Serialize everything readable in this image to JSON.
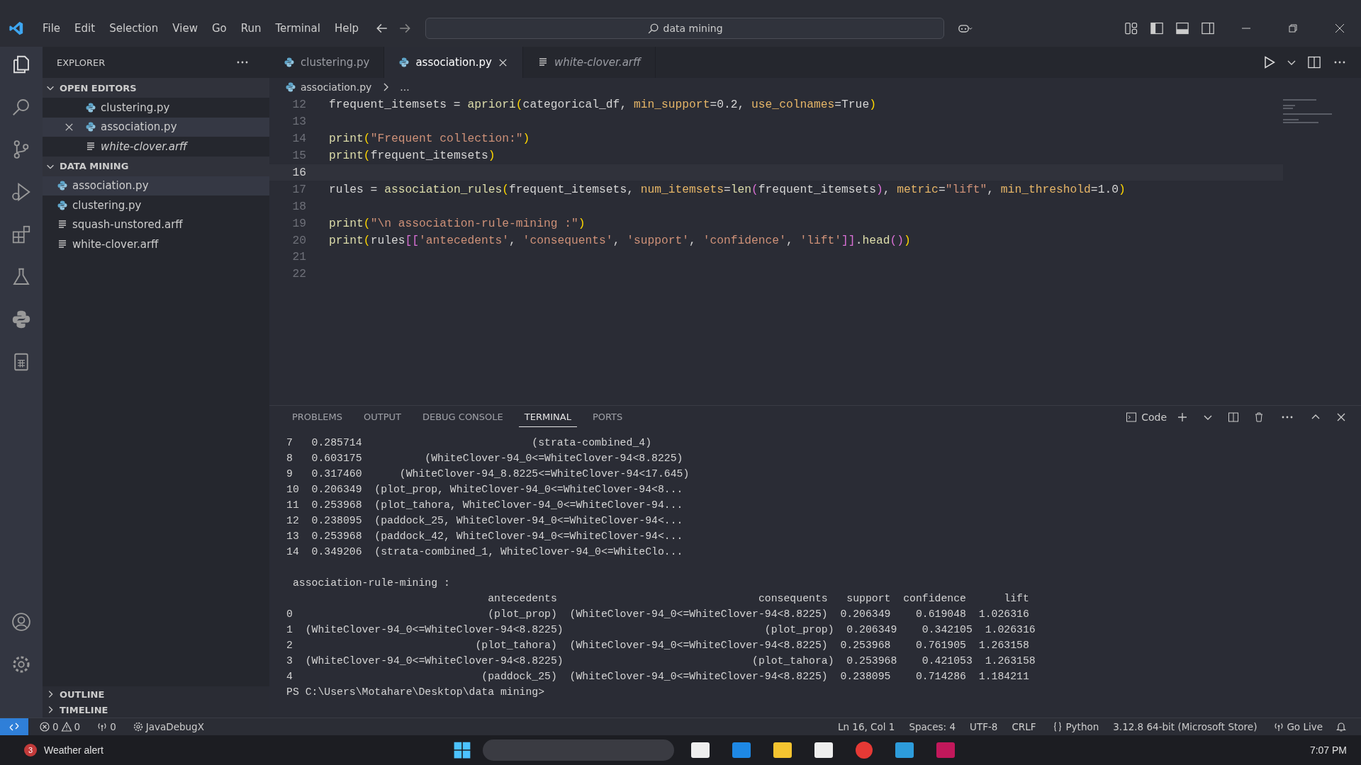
{
  "menu": [
    "File",
    "Edit",
    "Selection",
    "View",
    "Go",
    "Run",
    "Terminal",
    "Help"
  ],
  "search": {
    "value": "data mining"
  },
  "sidebar": {
    "title": "EXPLORER",
    "sections": [
      {
        "title": "OPEN EDITORS",
        "expanded": true,
        "items": [
          {
            "name": "clustering.py",
            "kind": "python",
            "selected": false,
            "preview": false,
            "closable": false
          },
          {
            "name": "association.py",
            "kind": "python",
            "selected": true,
            "preview": false,
            "closable": true
          },
          {
            "name": "white-clover.arff",
            "kind": "text",
            "selected": false,
            "preview": true,
            "closable": false
          }
        ]
      },
      {
        "title": "DATA MINING",
        "expanded": true,
        "items": [
          {
            "name": "association.py",
            "kind": "python",
            "selected": true,
            "preview": false
          },
          {
            "name": "clustering.py",
            "kind": "python",
            "selected": false,
            "preview": false
          },
          {
            "name": "squash-unstored.arff",
            "kind": "text",
            "selected": false,
            "preview": false
          },
          {
            "name": "white-clover.arff",
            "kind": "text",
            "selected": false,
            "preview": false
          }
        ]
      }
    ],
    "bottom_sections": [
      {
        "title": "OUTLINE",
        "expanded": false
      },
      {
        "title": "TIMELINE",
        "expanded": false
      }
    ]
  },
  "tabs": [
    {
      "label": "clustering.py",
      "kind": "python",
      "selected": false,
      "preview": false
    },
    {
      "label": "association.py",
      "kind": "python",
      "selected": true,
      "preview": false
    },
    {
      "label": "white-clover.arff",
      "kind": "text",
      "selected": false,
      "preview": true
    }
  ],
  "breadcrumb": {
    "file": "association.py",
    "rest": "..."
  },
  "editor": {
    "lines": [
      {
        "number": "12",
        "current": false,
        "tokens": [
          {
            "kind": "plain",
            "text": "frequent_itemsets = "
          },
          {
            "kind": "fn",
            "text": "apriori"
          },
          {
            "kind": "p1",
            "text": "("
          },
          {
            "kind": "plain",
            "text": "categorical_df, "
          },
          {
            "kind": "param",
            "text": "min_support"
          },
          {
            "kind": "plain",
            "text": "=0.2, "
          },
          {
            "kind": "param",
            "text": "use_colnames"
          },
          {
            "kind": "plain",
            "text": "=True"
          },
          {
            "kind": "p1",
            "text": ")"
          }
        ]
      },
      {
        "number": "13",
        "current": false
      },
      {
        "number": "14",
        "current": false,
        "tokens": [
          {
            "kind": "fn",
            "text": "print"
          },
          {
            "kind": "p1",
            "text": "("
          },
          {
            "kind": "str",
            "text": "\"Frequent collection:\""
          },
          {
            "kind": "p1",
            "text": ")"
          }
        ]
      },
      {
        "number": "15",
        "current": false,
        "tokens": [
          {
            "kind": "fn",
            "text": "print"
          },
          {
            "kind": "p1",
            "text": "("
          },
          {
            "kind": "plain",
            "text": "frequent_itemsets"
          },
          {
            "kind": "p1",
            "text": ")"
          }
        ]
      },
      {
        "number": "16",
        "current": true
      },
      {
        "number": "17",
        "current": false,
        "tokens": [
          {
            "kind": "plain",
            "text": "rules = "
          },
          {
            "kind": "fn",
            "text": "association_rules"
          },
          {
            "kind": "p1",
            "text": "("
          },
          {
            "kind": "plain",
            "text": "frequent_itemsets, "
          },
          {
            "kind": "param",
            "text": "num_itemsets"
          },
          {
            "kind": "plain",
            "text": "="
          },
          {
            "kind": "fn",
            "text": "len"
          },
          {
            "kind": "p2",
            "text": "("
          },
          {
            "kind": "plain",
            "text": "frequent_itemsets"
          },
          {
            "kind": "p2",
            "text": ")"
          },
          {
            "kind": "plain",
            "text": ", "
          },
          {
            "kind": "param",
            "text": "metric"
          },
          {
            "kind": "plain",
            "text": "="
          },
          {
            "kind": "str",
            "text": "\"lift\""
          },
          {
            "kind": "plain",
            "text": ", "
          },
          {
            "kind": "param",
            "text": "min_threshold"
          },
          {
            "kind": "plain",
            "text": "=1.0"
          },
          {
            "kind": "p1",
            "text": ")"
          }
        ]
      },
      {
        "number": "18",
        "current": false
      },
      {
        "number": "19",
        "current": false,
        "tokens": [
          {
            "kind": "fn",
            "text": "print"
          },
          {
            "kind": "p1",
            "text": "("
          },
          {
            "kind": "str",
            "text": "\"\\n association-rule-mining :\""
          },
          {
            "kind": "p1",
            "text": ")"
          }
        ]
      },
      {
        "number": "20",
        "current": false,
        "tokens": [
          {
            "kind": "fn",
            "text": "print"
          },
          {
            "kind": "p1",
            "text": "("
          },
          {
            "kind": "plain",
            "text": "rules"
          },
          {
            "kind": "p2",
            "text": "[["
          },
          {
            "kind": "str",
            "text": "'antecedents'"
          },
          {
            "kind": "plain",
            "text": ", "
          },
          {
            "kind": "str",
            "text": "'consequents'"
          },
          {
            "kind": "plain",
            "text": ", "
          },
          {
            "kind": "str",
            "text": "'support'"
          },
          {
            "kind": "plain",
            "text": ", "
          },
          {
            "kind": "str",
            "text": "'confidence'"
          },
          {
            "kind": "plain",
            "text": ", "
          },
          {
            "kind": "str",
            "text": "'lift'"
          },
          {
            "kind": "p2",
            "text": "]]"
          },
          {
            "kind": "plain",
            "text": "."
          },
          {
            "kind": "fn",
            "text": "head"
          },
          {
            "kind": "p2",
            "text": "()"
          },
          {
            "kind": "p1",
            "text": ")"
          }
        ]
      },
      {
        "number": "21",
        "current": false
      },
      {
        "number": "22",
        "current": false
      }
    ]
  },
  "panel": {
    "tabs": [
      {
        "label": "PROBLEMS",
        "selected": false
      },
      {
        "label": "OUTPUT",
        "selected": false
      },
      {
        "label": "DEBUG CONSOLE",
        "selected": false
      },
      {
        "label": "TERMINAL",
        "selected": true
      },
      {
        "label": "PORTS",
        "selected": false
      }
    ],
    "terminal_name": "Code",
    "blocks": [
      [
        "7   0.285714                           (strata-combined_4)",
        "8   0.603175          (WhiteClover-94_0<=WhiteClover-94<8.8225)",
        "9   0.317460      (WhiteClover-94_8.8225<=WhiteClover-94<17.645)",
        "10  0.206349  (plot_prop, WhiteClover-94_0<=WhiteClover-94<8...",
        "11  0.253968  (plot_tahora, WhiteClover-94_0<=WhiteClover-94...",
        "12  0.238095  (paddock_25, WhiteClover-94_0<=WhiteClover-94<...",
        "13  0.253968  (paddock_42, WhiteClover-94_0<=WhiteClover-94<...",
        "14  0.349206  (strata-combined_1, WhiteClover-94_0<=WhiteClo..."
      ],
      [
        " association-rule-mining :",
        "                                antecedents                                consequents   support  confidence      lift",
        "0                               (plot_prop)  (WhiteClover-94_0<=WhiteClover-94<8.8225)  0.206349    0.619048  1.026316",
        "1  (WhiteClover-94_0<=WhiteClover-94<8.8225)                                (plot_prop)  0.206349    0.342105  1.026316",
        "2                             (plot_tahora)  (WhiteClover-94_0<=WhiteClover-94<8.8225)  0.253968    0.761905  1.263158",
        "3  (WhiteClover-94_0<=WhiteClover-94<8.8225)                              (plot_tahora)  0.253968    0.421053  1.263158",
        "4                              (paddock_25)  (WhiteClover-94_0<=WhiteClover-94<8.8225)  0.238095    0.714286  1.184211",
        "PS C:\\Users\\Motahare\\Desktop\\data mining>"
      ]
    ]
  },
  "status_bar": {
    "errors": "0",
    "warnings": "0",
    "ports": "0",
    "debug": "JavaDebugX",
    "right": [
      {
        "kind": "text",
        "text": "Ln 16, Col 1"
      },
      {
        "kind": "text",
        "text": "Spaces: 4"
      },
      {
        "kind": "text",
        "text": "UTF-8"
      },
      {
        "kind": "text",
        "text": "CRLF"
      },
      {
        "kind": "lang",
        "text": "Python"
      },
      {
        "kind": "text",
        "text": "3.12.8 64-bit (Microsoft Store)"
      },
      {
        "kind": "live",
        "text": "Go Live"
      }
    ]
  },
  "taskbar": {
    "weather": "Weather alert",
    "badge": "3",
    "time": "7:07 PM"
  }
}
